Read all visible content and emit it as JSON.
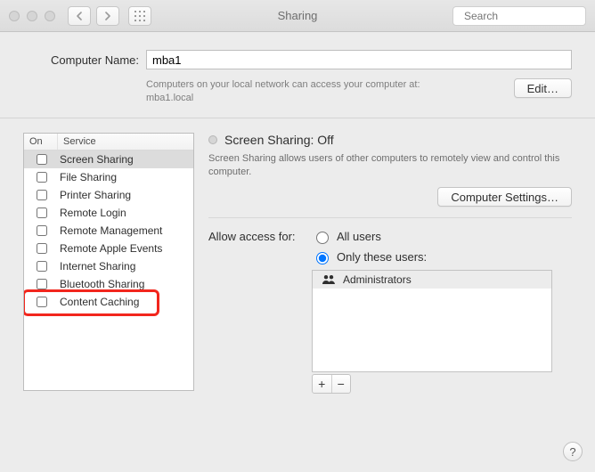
{
  "titlebar": {
    "title": "Sharing",
    "search_placeholder": "Search"
  },
  "computer_name": {
    "label": "Computer Name:",
    "value": "mba1",
    "sub_line1": "Computers on your local network can access your computer at:",
    "sub_line2": "mba1.local",
    "edit_label": "Edit…"
  },
  "services": {
    "col_on": "On",
    "col_service": "Service",
    "items": [
      {
        "label": "Screen Sharing",
        "on": false,
        "selected": true
      },
      {
        "label": "File Sharing",
        "on": false
      },
      {
        "label": "Printer Sharing",
        "on": false
      },
      {
        "label": "Remote Login",
        "on": false
      },
      {
        "label": "Remote Management",
        "on": false
      },
      {
        "label": "Remote Apple Events",
        "on": false
      },
      {
        "label": "Internet Sharing",
        "on": false
      },
      {
        "label": "Bluetooth Sharing",
        "on": false
      },
      {
        "label": "Content Caching",
        "on": false,
        "highlighted": true
      }
    ]
  },
  "detail": {
    "status_title": "Screen Sharing: Off",
    "status_desc": "Screen Sharing allows users of other computers to remotely view and control this computer.",
    "computer_settings_label": "Computer Settings…",
    "access_label": "Allow access for:",
    "radio_all": "All users",
    "radio_only": "Only these users:",
    "selected_radio": "only",
    "users": [
      {
        "name": "Administrators",
        "icon": "people-icon"
      }
    ],
    "add_label": "+",
    "remove_label": "−"
  },
  "help_label": "?"
}
